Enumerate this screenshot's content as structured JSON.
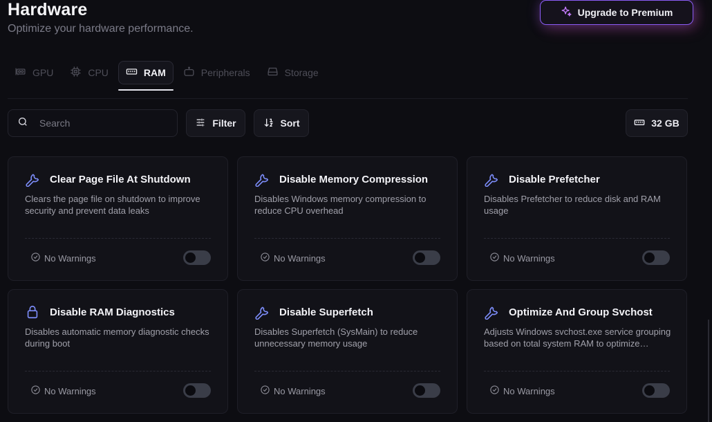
{
  "header": {
    "title": "Hardware",
    "subtitle": "Optimize your hardware performance.",
    "premium_label": "Upgrade to Premium"
  },
  "tabs": [
    {
      "label": "GPU",
      "icon": "gpu-icon",
      "active": false
    },
    {
      "label": "CPU",
      "icon": "cpu-icon",
      "active": false
    },
    {
      "label": "RAM",
      "icon": "ram-icon",
      "active": true
    },
    {
      "label": "Peripherals",
      "icon": "peripherals-icon",
      "active": false
    },
    {
      "label": "Storage",
      "icon": "storage-icon",
      "active": false
    }
  ],
  "toolbar": {
    "search_placeholder": "Search",
    "filter_label": "Filter",
    "sort_label": "Sort",
    "ram_size": "32 GB"
  },
  "colors": {
    "accent": "#8b5cf6",
    "pink": "#ec4899",
    "icon_blue": "#7c8cf8"
  },
  "cards": [
    {
      "title": "Clear Page File At Shutdown",
      "desc": "Clears the page file on shutdown to improve security and prevent data leaks",
      "status": "No Warnings",
      "icon": "wrench-icon",
      "enabled": false
    },
    {
      "title": "Disable Memory Compression",
      "desc": "Disables Windows memory compression to reduce CPU overhead",
      "status": "No Warnings",
      "icon": "wrench-icon",
      "enabled": false
    },
    {
      "title": "Disable Prefetcher",
      "desc": "Disables Prefetcher to reduce disk and RAM usage",
      "status": "No Warnings",
      "icon": "wrench-icon",
      "enabled": false
    },
    {
      "title": "Disable RAM Diagnostics",
      "desc": "Disables automatic memory diagnostic checks during boot",
      "status": "No Warnings",
      "icon": "lock-icon",
      "enabled": false
    },
    {
      "title": "Disable Superfetch",
      "desc": "Disables Superfetch (SysMain) to reduce unnecessary memory usage",
      "status": "No Warnings",
      "icon": "wrench-icon",
      "enabled": false
    },
    {
      "title": "Optimize And Group Svchost",
      "desc": "Adjusts Windows svchost.exe service grouping based on total system RAM to optimize memory usage",
      "status": "No Warnings",
      "icon": "wrench-icon",
      "enabled": false
    }
  ]
}
